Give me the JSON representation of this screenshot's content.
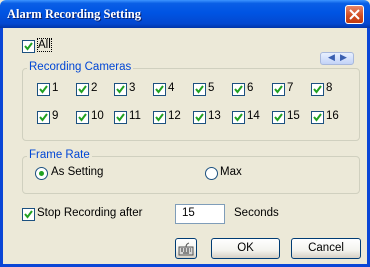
{
  "window": {
    "title": "Alarm Recording Setting"
  },
  "all_label": "All",
  "recording_cameras": {
    "legend": "Recording Cameras",
    "cameras": [
      "1",
      "2",
      "3",
      "4",
      "5",
      "6",
      "7",
      "8",
      "9",
      "10",
      "11",
      "12",
      "13",
      "14",
      "15",
      "16"
    ]
  },
  "frame_rate": {
    "legend": "Frame Rate",
    "options": [
      "As Setting",
      "Max"
    ],
    "selected": "As Setting"
  },
  "stop_recording": {
    "label": "Stop Recording after",
    "value": "15",
    "unit": "Seconds"
  },
  "buttons": {
    "ok": "OK",
    "cancel": "Cancel"
  },
  "icons": {
    "close": "close-icon",
    "keyboard": "keyboard-icon",
    "nav": "left-right-arrows-icon"
  }
}
